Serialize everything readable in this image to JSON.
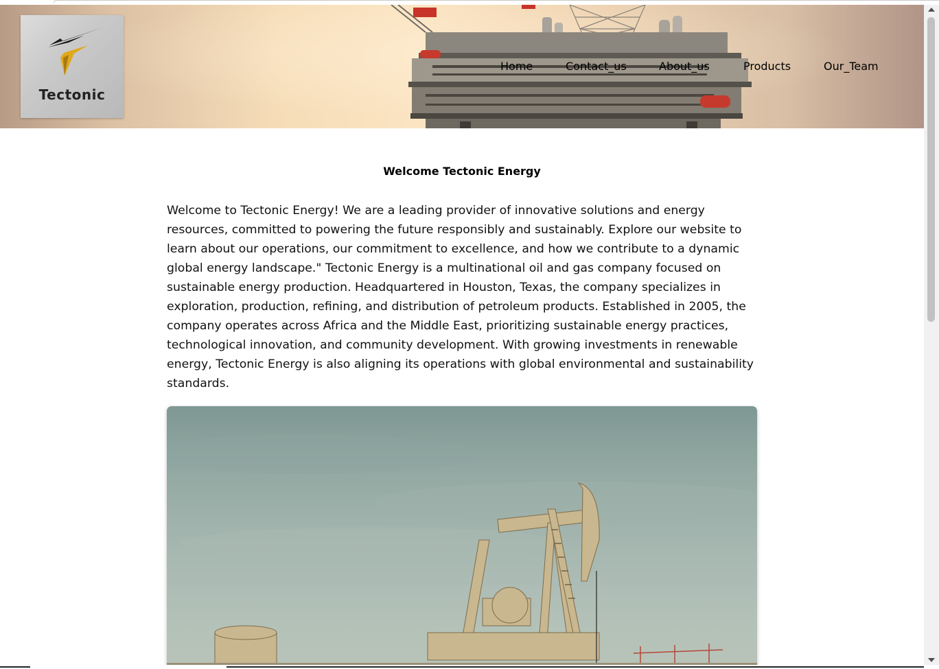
{
  "header": {
    "logo": {
      "text": "Tectonic",
      "icon": "tectonic-bolt-logo"
    },
    "background_image": "offshore-oil-rig-photo",
    "nav": [
      {
        "label": "Home"
      },
      {
        "label": "Contact_us"
      },
      {
        "label": "About_us"
      },
      {
        "label": "Products"
      },
      {
        "label": "Our_Team"
      }
    ]
  },
  "main": {
    "title": "Welcome Tectonic Energy",
    "paragraph": "Welcome to Tectonic Energy! We are a leading provider of innovative solutions and energy resources, committed to powering the future responsibly and sustainably. Explore our website to learn about our operations, our commitment to excellence, and how we contribute to a dynamic global energy landscape.\" Tectonic Energy is a multinational oil and gas company focused on sustainable energy production. Headquartered in Houston, Texas, the company specializes in exploration, production, refining, and distribution of petroleum products. Established in 2005, the company operates across Africa and the Middle East, prioritizing sustainable energy practices, technological innovation, and community development. With growing investments in renewable energy, Tectonic Energy is also aligning its operations with global environmental and sustainability standards.",
    "image": "oil-pumpjack-photo"
  },
  "colors": {
    "logo_accent": "#e0a81c",
    "text": "#000000"
  }
}
